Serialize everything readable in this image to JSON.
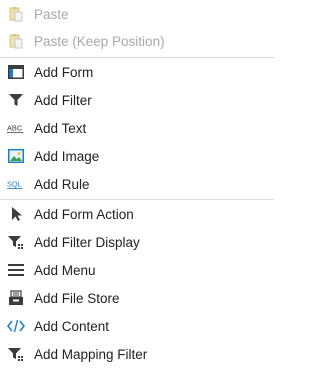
{
  "context_menu": {
    "items": [
      {
        "label": "Paste",
        "icon": "paste-icon",
        "enabled": false
      },
      {
        "label": "Paste (Keep Position)",
        "icon": "paste-icon",
        "enabled": false
      },
      {
        "label": "Add Form",
        "icon": "form-icon",
        "enabled": true
      },
      {
        "label": "Add Filter",
        "icon": "filter-icon",
        "enabled": true
      },
      {
        "label": "Add Text",
        "icon": "text-abc-icon",
        "icon_text": "ABC",
        "enabled": true
      },
      {
        "label": "Add Image",
        "icon": "image-icon",
        "enabled": true
      },
      {
        "label": "Add Rule",
        "icon": "sql-rule-icon",
        "icon_text": "SQL",
        "enabled": true
      },
      {
        "label": "Add Form Action",
        "icon": "cursor-arrow-icon",
        "enabled": true
      },
      {
        "label": "Add Filter Display",
        "icon": "filter-display-icon",
        "enabled": true
      },
      {
        "label": "Add Menu",
        "icon": "hamburger-menu-icon",
        "enabled": true
      },
      {
        "label": "Add File Store",
        "icon": "file-store-icon",
        "enabled": true
      },
      {
        "label": "Add Content",
        "icon": "code-content-icon",
        "enabled": true
      },
      {
        "label": "Add Mapping Filter",
        "icon": "mapping-filter-icon",
        "enabled": true
      }
    ]
  },
  "colors": {
    "disabled_text": "#a8a8a8",
    "text": "#222222",
    "icon_dark": "#3c3c3c",
    "accent_blue": "#1e7fd0",
    "image_green": "#3aa043",
    "paste_yellow": "#e8d89a",
    "separator": "#d9d9d9"
  }
}
